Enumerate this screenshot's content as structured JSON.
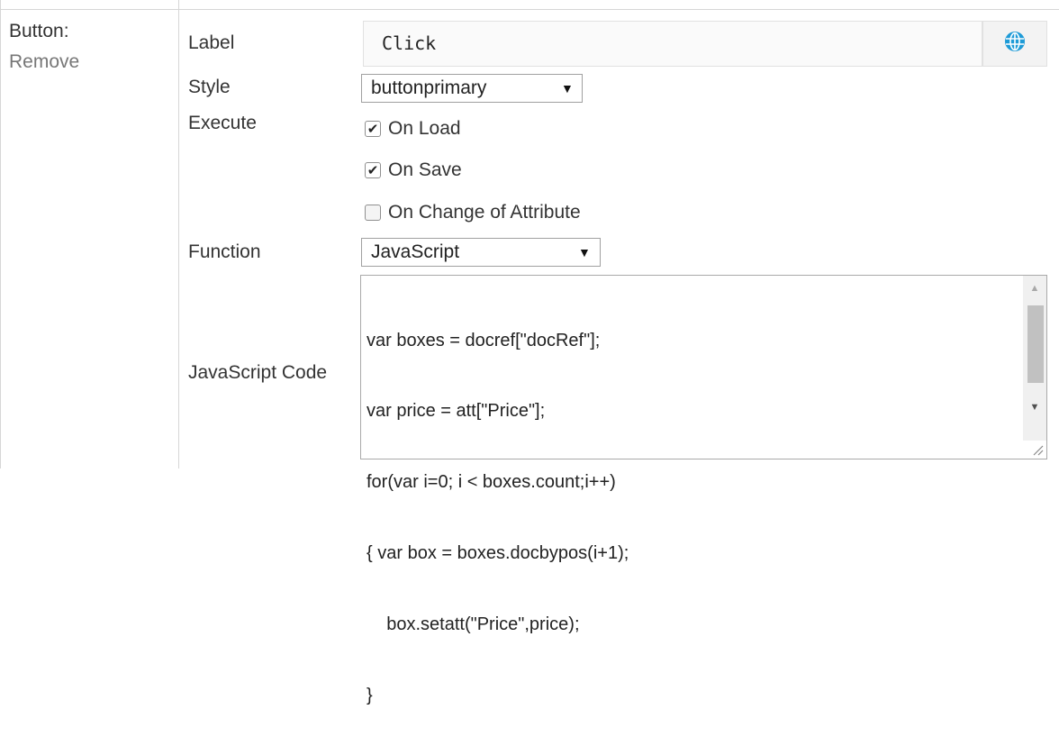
{
  "section": {
    "title": "Button:",
    "remove_link": "Remove"
  },
  "fields": {
    "label": {
      "name": "Label",
      "value": "Click"
    },
    "style": {
      "name": "Style",
      "selected": "buttonprimary"
    },
    "execute": {
      "name": "Execute",
      "options": [
        {
          "label": "On Load",
          "checked": true
        },
        {
          "label": "On Save",
          "checked": true
        },
        {
          "label": "On Change of Attribute",
          "checked": false
        }
      ]
    },
    "function": {
      "name": "Function",
      "selected": "JavaScript"
    },
    "code": {
      "name": "JavaScript Code",
      "lines": [
        "var boxes = docref[\"docRef\"];",
        "var price = att[\"Price\"];",
        "for(var i=0; i < boxes.count;i++)",
        "{ var box = boxes.docbypos(i+1);",
        "    box.setatt(\"Price\",price);",
        "}"
      ]
    }
  },
  "icons": {
    "globe": "globe-icon",
    "dropdown": "triangle-down-icon",
    "check": "checkmark-icon"
  },
  "colors": {
    "globe_icon": "#1e9bd7",
    "border": "#d6d6d6",
    "remove_link": "#777777"
  }
}
